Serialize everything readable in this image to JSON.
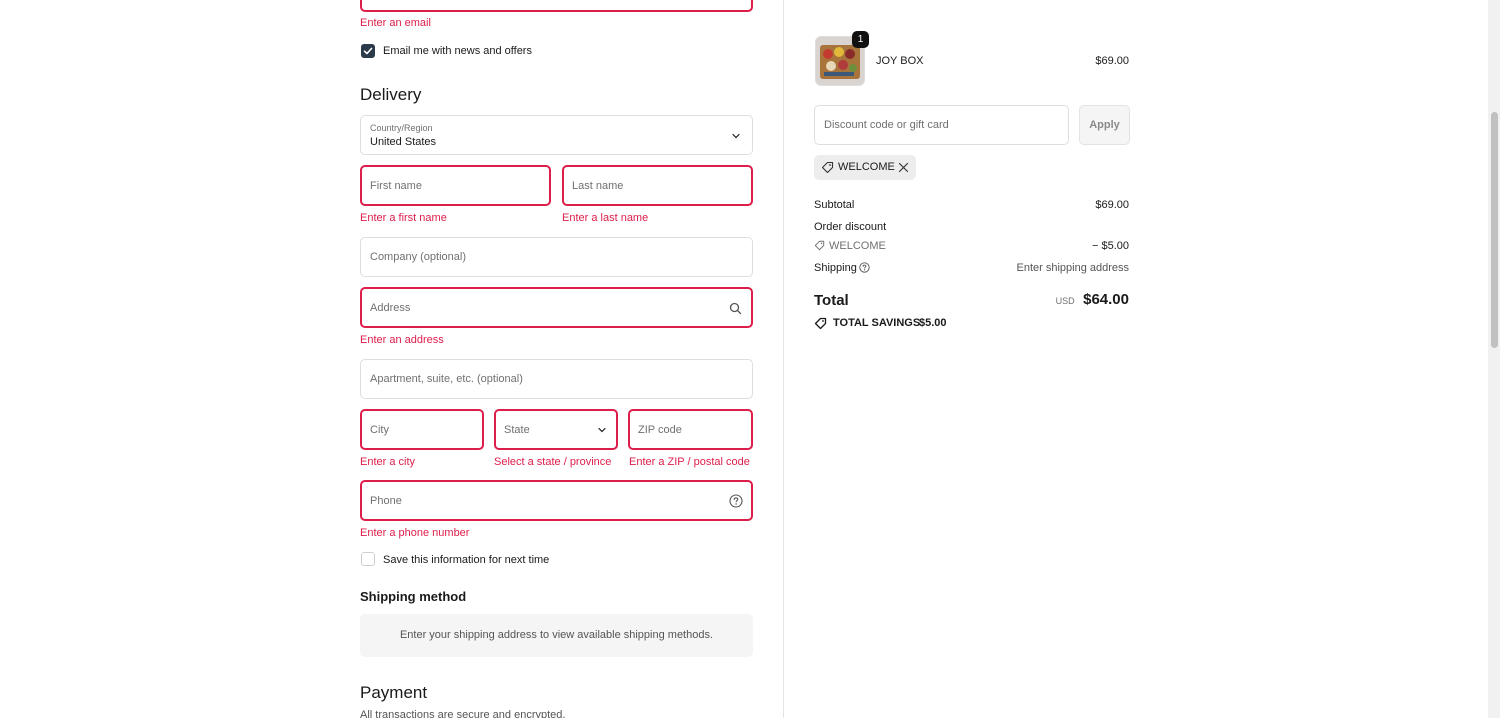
{
  "contact": {
    "email_error": "Enter an email",
    "newsletter_label": "Email me with news and offers",
    "newsletter_checked": true
  },
  "delivery": {
    "heading": "Delivery",
    "country_label": "Country/Region",
    "country_value": "United States",
    "first_name_placeholder": "First name",
    "first_name_error": "Enter a first name",
    "last_name_placeholder": "Last name",
    "last_name_error": "Enter a last name",
    "company_placeholder": "Company (optional)",
    "address_placeholder": "Address",
    "address_error": "Enter an address",
    "apartment_placeholder": "Apartment, suite, etc. (optional)",
    "city_placeholder": "City",
    "city_error": "Enter a city",
    "state_placeholder": "State",
    "state_error": "Select a state / province",
    "zip_placeholder": "ZIP code",
    "zip_error": "Enter a ZIP / postal code",
    "phone_placeholder": "Phone",
    "phone_error": "Enter a phone number",
    "save_info_label": "Save this information for next time",
    "save_info_checked": false
  },
  "shipping_method": {
    "heading": "Shipping method",
    "message": "Enter your shipping address to view available shipping methods."
  },
  "payment": {
    "heading": "Payment",
    "subtext": "All transactions are secure and encrypted."
  },
  "summary": {
    "product": {
      "name": "JOY BOX",
      "price": "$69.00",
      "quantity": "1"
    },
    "discount_placeholder": "Discount code or gift card",
    "apply_label": "Apply",
    "applied_code": "WELCOME",
    "subtotal_label": "Subtotal",
    "subtotal_value": "$69.00",
    "order_discount_label": "Order discount",
    "discount_code": "WELCOME",
    "discount_value": "− $5.00",
    "shipping_label": "Shipping",
    "shipping_value": "Enter shipping address",
    "total_label": "Total",
    "currency": "USD",
    "total_value": "$64.00",
    "savings_label": "TOTAL SAVINGS",
    "savings_value": "$5.00"
  },
  "colors": {
    "error": "#dd1d4a",
    "checkbox_checked": "#2b3a4a",
    "border": "#dedede"
  }
}
